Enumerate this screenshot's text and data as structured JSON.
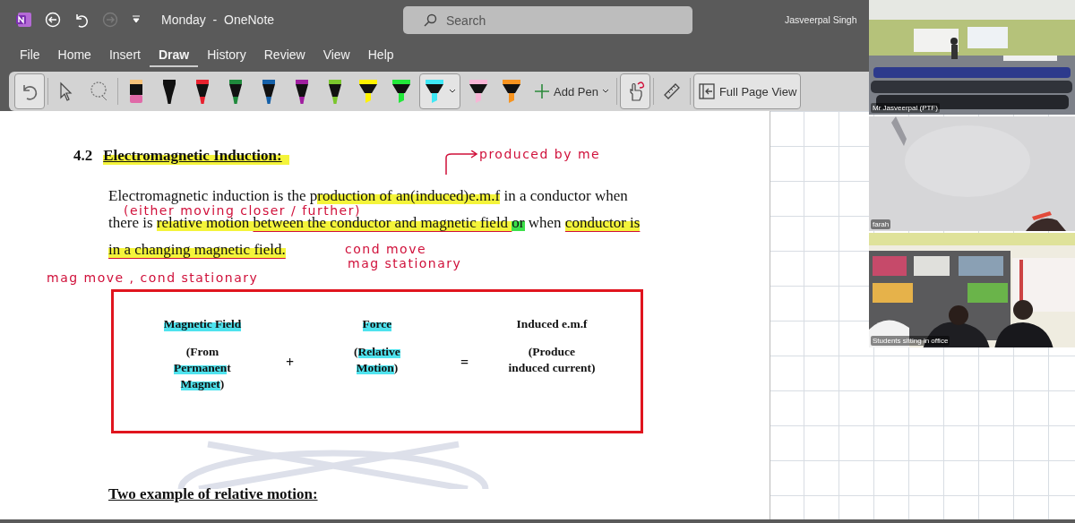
{
  "title_bar": {
    "title": "Monday  -  OneNote",
    "search_placeholder": "Search",
    "user": "Jasveerpal Singh"
  },
  "menu_tabs": [
    {
      "label": "File",
      "selected": false
    },
    {
      "label": "Home",
      "selected": false
    },
    {
      "label": "Insert",
      "selected": false
    },
    {
      "label": "Draw",
      "selected": true
    },
    {
      "label": "History",
      "selected": false
    },
    {
      "label": "Review",
      "selected": false
    },
    {
      "label": "View",
      "selected": false
    },
    {
      "label": "Help",
      "selected": false
    }
  ],
  "pens": [
    {
      "kind": "eraser",
      "color": "#e06aa8",
      "selected": false
    },
    {
      "kind": "pen",
      "color": "#111111",
      "selected": false
    },
    {
      "kind": "pen",
      "color": "#e8212e",
      "selected": false
    },
    {
      "kind": "pen",
      "color": "#1f8a3c",
      "selected": false
    },
    {
      "kind": "pen",
      "color": "#1560a8",
      "selected": false
    },
    {
      "kind": "pen",
      "color": "#a01fa0",
      "selected": false
    },
    {
      "kind": "pen",
      "color": "#7bc62d",
      "selected": false
    },
    {
      "kind": "highlighter",
      "color": "#fff200",
      "selected": false
    },
    {
      "kind": "highlighter",
      "color": "#22e83a",
      "selected": false
    },
    {
      "kind": "highlighter",
      "color": "#3fe8f5",
      "selected": true
    },
    {
      "kind": "highlighter",
      "color": "#f7b5d5",
      "selected": false
    },
    {
      "kind": "highlighter",
      "color": "#f7931e",
      "selected": false
    }
  ],
  "add_pen": "Add Pen",
  "full_page_view": "Full Page View",
  "page": {
    "heading_number": "4.2",
    "heading": "Electromagnetic Induction:",
    "lines": [
      [
        {
          "text": "Electromagnetic induction is the p",
          "highlight": false,
          "ink": false
        },
        {
          "text": "roduction of an(induced)e.m.f",
          "highlight": true,
          "color": "#f4f43a",
          "ink": false
        },
        {
          "text": " in a conductor when",
          "highlight": false,
          "ink": false
        }
      ],
      [
        {
          "text": "there is ",
          "highlight": false,
          "ink": false
        },
        {
          "text": "relative motion ",
          "highlight": true,
          "color": "#f4f43a",
          "ink": false
        },
        {
          "text": "between the conductor and magnetic field ",
          "highlight": true,
          "color": "#f4f43a",
          "ink": true
        },
        {
          "text": "or",
          "highlight": true,
          "color": "#3ce04a",
          "ink": false
        },
        {
          "text": " when ",
          "highlight": false,
          "ink": false
        },
        {
          "text": "conductor is",
          "highlight": true,
          "color": "#f4f43a",
          "ink": true
        }
      ],
      [
        {
          "text": "in a changing magnetic field.",
          "highlight": true,
          "color": "#f4f43a",
          "ink": true
        }
      ]
    ],
    "equation": [
      {
        "kind": "term",
        "title": "Magnetic Field",
        "title_hl": true,
        "detail": [
          {
            "text": "(From ",
            "hl": false
          },
          {
            "text": "Permanen",
            "hl": true
          },
          {
            "text": "t ",
            "hl": false
          },
          {
            "text": "Magnet",
            "hl": true
          },
          {
            "text": ")",
            "hl": false
          }
        ]
      },
      {
        "kind": "operator",
        "symbol": "+"
      },
      {
        "kind": "term",
        "title": "Force",
        "title_hl": true,
        "detail": [
          {
            "text": "(",
            "hl": false
          },
          {
            "text": "Relative Motion",
            "hl": true
          },
          {
            "text": ")",
            "hl": false
          }
        ]
      },
      {
        "kind": "operator",
        "symbol": "="
      },
      {
        "kind": "term",
        "title": "Induced e.m.f",
        "title_hl": false,
        "detail": [
          {
            "text": "(Produce induced current)",
            "hl": false
          }
        ]
      }
    ],
    "subheading": "Two example of relative motion:"
  },
  "ink_notes": [
    {
      "text": "produced by me"
    },
    {
      "text": "(either moving closer / further)"
    },
    {
      "text": "cond move"
    },
    {
      "text": "mag stationary"
    },
    {
      "text": "mag move , cond stationary"
    }
  ],
  "video_tiles": [
    {
      "name": "Mr Jasveerpal (PTF)",
      "kind": "classroom"
    },
    {
      "name": "farah",
      "kind": "wall"
    },
    {
      "name": "Students sitting in office",
      "kind": "office"
    }
  ]
}
